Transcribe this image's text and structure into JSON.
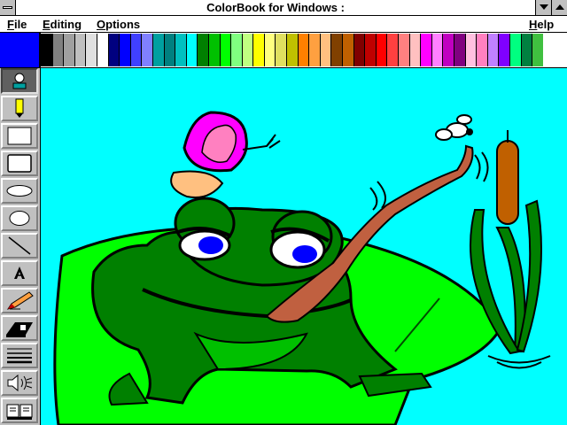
{
  "window": {
    "title": "ColorBook for Windows :"
  },
  "menu": {
    "file": "File",
    "editing": "Editing",
    "options": "Options",
    "help": "Help"
  },
  "palette": {
    "current_color": "#0000ff",
    "swatches": [
      "#000000",
      "#808080",
      "#a0a0a0",
      "#c0c0c0",
      "#e0e0e0",
      "#ffffff",
      "#000080",
      "#0000ff",
      "#4040ff",
      "#8080ff",
      "#00a0a0",
      "#008080",
      "#00c0c0",
      "#00ffff",
      "#008000",
      "#00c000",
      "#00ff00",
      "#80ff80",
      "#c0ff80",
      "#ffff00",
      "#ffff80",
      "#e0e060",
      "#c0c000",
      "#ff8000",
      "#ffa040",
      "#ffc080",
      "#804000",
      "#c06000",
      "#800000",
      "#c00000",
      "#ff0000",
      "#ff4040",
      "#ff8080",
      "#ffc0c0",
      "#ff00ff",
      "#ff80ff",
      "#c000c0",
      "#800080",
      "#ffc0e0",
      "#ff80c0",
      "#c080ff",
      "#8000ff",
      "#00ff80",
      "#008040",
      "#40c040"
    ]
  },
  "tools": [
    "user-icon",
    "pencil-icon",
    "rectangle-outline-icon",
    "filled-rectangle-icon",
    "ellipse-outline-icon",
    "filled-ellipse-icon",
    "line-icon",
    "text-icon",
    "crayon-icon",
    "paint-roller-icon",
    "line-width-icon",
    "speaker-icon",
    "book-icon"
  ]
}
